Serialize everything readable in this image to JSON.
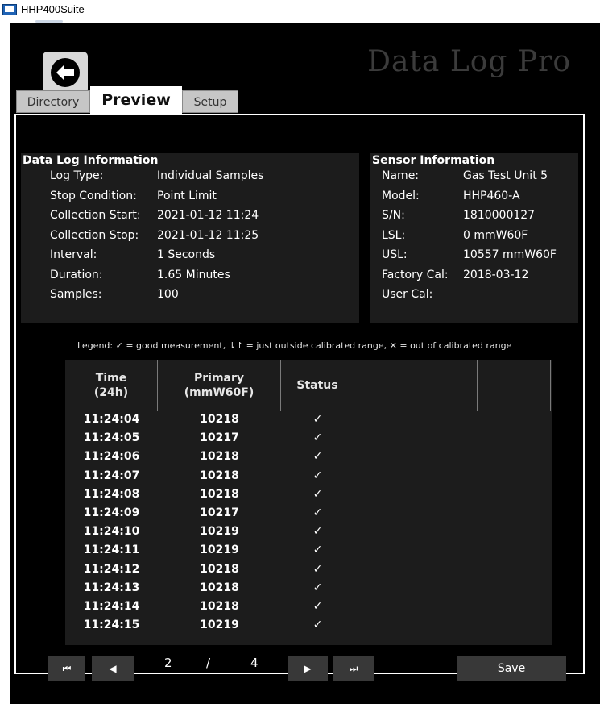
{
  "window": {
    "title": "HHP400Suite"
  },
  "app": {
    "brand_title": "Data Log Pro"
  },
  "tabs": [
    {
      "label": "Directory",
      "active": false
    },
    {
      "label": "Preview",
      "active": true
    },
    {
      "label": "Setup",
      "active": false
    }
  ],
  "data_log_info": {
    "title": "Data Log Information",
    "rows": [
      {
        "label": "Log Type:",
        "value": "Individual Samples"
      },
      {
        "label": "Stop Condition:",
        "value": "Point Limit"
      },
      {
        "label": "Collection Start:",
        "value": "2021-01-12  11:24"
      },
      {
        "label": "Collection Stop:",
        "value": "2021-01-12  11:25"
      },
      {
        "label": "Interval:",
        "value": "1 Seconds"
      },
      {
        "label": "Duration:",
        "value": "1.65 Minutes"
      },
      {
        "label": "Samples:",
        "value": "100"
      }
    ]
  },
  "sensor_info": {
    "title": "Sensor Information",
    "rows": [
      {
        "label": "Name:",
        "value": "Gas Test Unit 5"
      },
      {
        "label": "Model:",
        "value": "HHP460-A"
      },
      {
        "label": "S/N:",
        "value": "1810000127"
      },
      {
        "label": "LSL:",
        "value": "0 mmW60F"
      },
      {
        "label": "USL:",
        "value": "10557 mmW60F"
      },
      {
        "label": "Factory Cal:",
        "value": "2018-03-12"
      },
      {
        "label": "User Cal:",
        "value": ""
      }
    ]
  },
  "legend": "Legend:  ✓ = good measurement,  ⇂↾ = just outside calibrated range,  ✕ = out of calibrated range",
  "table": {
    "columns": [
      "Time\n(24h)",
      "Primary\n(mmW60F)",
      "Status",
      "",
      ""
    ],
    "rows": [
      {
        "time": "11:24:04",
        "primary": "10218",
        "status": "✓"
      },
      {
        "time": "11:24:05",
        "primary": "10217",
        "status": "✓"
      },
      {
        "time": "11:24:06",
        "primary": "10218",
        "status": "✓"
      },
      {
        "time": "11:24:07",
        "primary": "10218",
        "status": "✓"
      },
      {
        "time": "11:24:08",
        "primary": "10218",
        "status": "✓"
      },
      {
        "time": "11:24:09",
        "primary": "10217",
        "status": "✓"
      },
      {
        "time": "11:24:10",
        "primary": "10219",
        "status": "✓"
      },
      {
        "time": "11:24:11",
        "primary": "10219",
        "status": "✓"
      },
      {
        "time": "11:24:12",
        "primary": "10218",
        "status": "✓"
      },
      {
        "time": "11:24:13",
        "primary": "10218",
        "status": "✓"
      },
      {
        "time": "11:24:14",
        "primary": "10218",
        "status": "✓"
      },
      {
        "time": "11:24:15",
        "primary": "10219",
        "status": "✓"
      }
    ]
  },
  "pagination": {
    "first_glyph": "⏮",
    "prev_glyph": "◀",
    "next_glyph": "▶",
    "last_glyph": "⏭",
    "current_page": "2",
    "separator": "/",
    "total_pages": "4"
  },
  "actions": {
    "save_label": "Save"
  }
}
